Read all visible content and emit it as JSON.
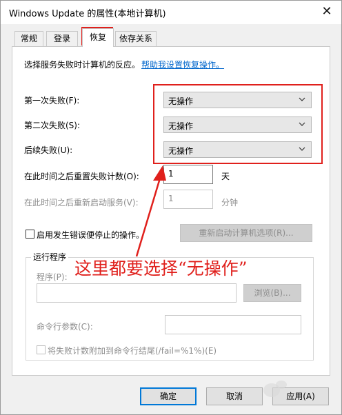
{
  "window": {
    "title": "Windows Update 的属性(本地计算机)",
    "close_glyph": "✕"
  },
  "tabs": [
    {
      "label": "常规",
      "active": false
    },
    {
      "label": "登录",
      "active": false
    },
    {
      "label": "恢复",
      "active": true
    },
    {
      "label": "依存关系",
      "active": false
    }
  ],
  "recovery": {
    "intro_text": "选择服务失败时计算机的反应。",
    "help_link": "帮助我设置恢复操作。",
    "first_failure_label": "第一次失败(F):",
    "first_failure_value": "无操作",
    "second_failure_label": "第二次失败(S):",
    "second_failure_value": "无操作",
    "subsequent_failure_label": "后续失败(U):",
    "subsequent_failure_value": "无操作",
    "reset_count_label": "在此时间之后重置失败计数(O):",
    "reset_count_value": "1",
    "reset_count_unit": "天",
    "restart_service_label": "在此时间之后重新启动服务(V):",
    "restart_service_value": "1",
    "restart_service_unit": "分钟",
    "enable_actions_label": "启用发生错误便停止的操作。",
    "restart_computer_button": "重新启动计算机选项(R)..."
  },
  "run_program": {
    "group_title": "运行程序",
    "program_label": "程序(P):",
    "program_value": "",
    "browse_button": "浏览(B)...",
    "cmd_args_label": "命令行参数(C):",
    "cmd_args_value": "",
    "append_fail_count_label": "将失败计数附加到命令行结尾(/fail=%1%)(E)"
  },
  "footer": {
    "ok_button": "确定",
    "cancel_button": "取消",
    "apply_button": "应用(A)"
  },
  "annotation": {
    "text": "这里都要选择“无操作”",
    "color": "#e0201c"
  },
  "colors": {
    "accent": "#0078d7",
    "link": "#0066cc",
    "annotation_red": "#e0201c"
  }
}
